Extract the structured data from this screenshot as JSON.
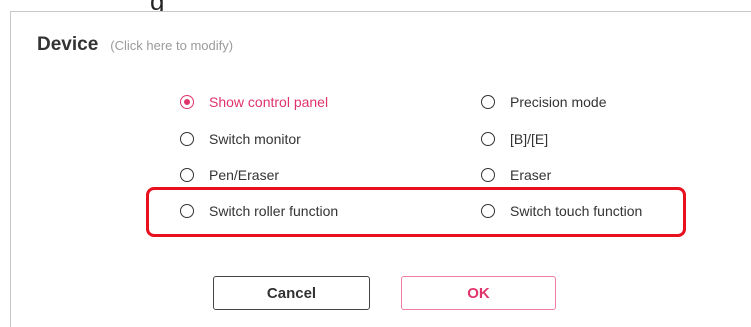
{
  "top_fragment": "g",
  "section": {
    "title": "Device",
    "hint": "(Click here to modify)"
  },
  "options": {
    "show_control_panel": "Show control panel",
    "precision_mode": "Precision mode",
    "switch_monitor": "Switch monitor",
    "b_e": "[B]/[E]",
    "pen_eraser": "Pen/Eraser",
    "eraser": "Eraser",
    "switch_roller_function": "Switch roller function",
    "switch_touch_function": "Switch touch function"
  },
  "selected_option": "Show control panel",
  "buttons": {
    "cancel": "Cancel",
    "ok": "OK"
  },
  "colors": {
    "accent": "#e0336a",
    "highlight": "#e8101c"
  }
}
